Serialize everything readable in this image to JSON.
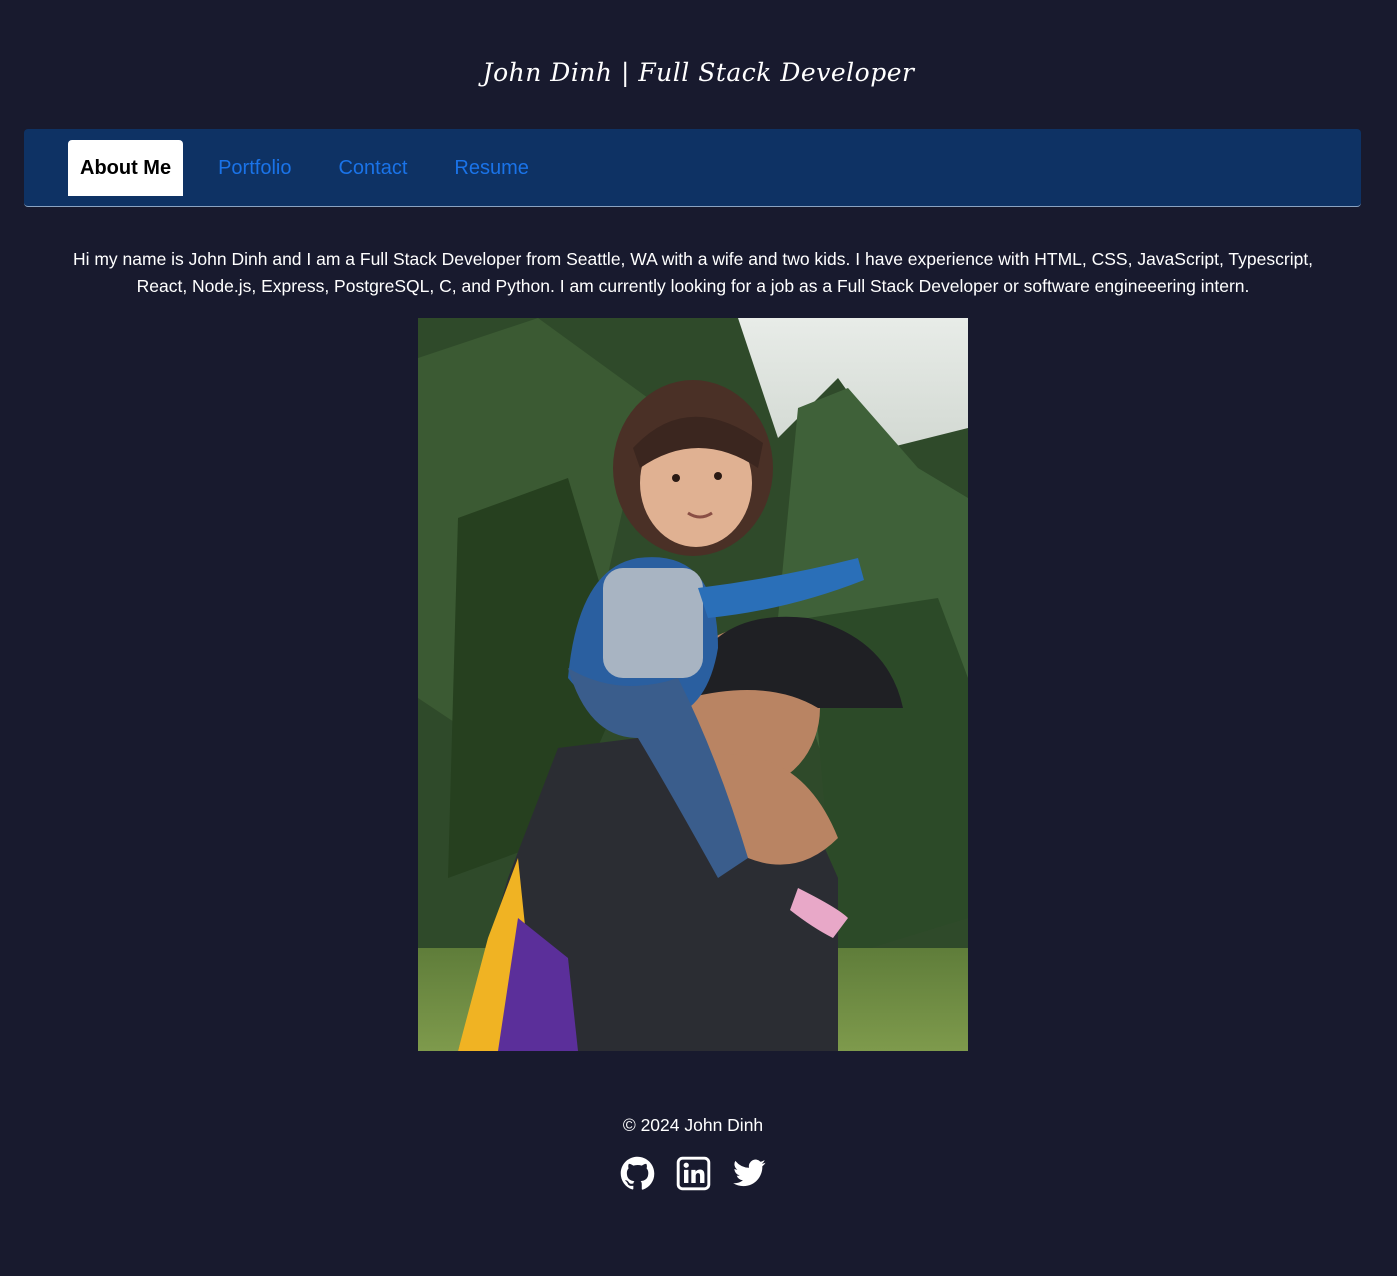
{
  "header": {
    "title": "John Dinh | Full Stack Developer"
  },
  "nav": {
    "tabs": [
      {
        "label": "About Me",
        "active": true
      },
      {
        "label": "Portfolio",
        "active": false
      },
      {
        "label": "Contact",
        "active": false
      },
      {
        "label": "Resume",
        "active": false
      }
    ]
  },
  "about": {
    "text": "Hi my name is John Dinh and I am a Full Stack Developer from Seattle, WA with a wife and two kids. I have experience with HTML, CSS, JavaScript, Typescript, React, Node.js, Express, PostgreSQL, C, and Python. I am currently looking for a job as a Full Stack Developer or software engineeering intern."
  },
  "footer": {
    "copyright": "© 2024 John Dinh",
    "social": [
      "github-icon",
      "linkedin-icon",
      "twitter-icon"
    ]
  },
  "colors": {
    "background": "#181a2e",
    "navbar": "#0e3264",
    "link": "#1a73e8",
    "active_tab_bg": "#ffffff"
  }
}
